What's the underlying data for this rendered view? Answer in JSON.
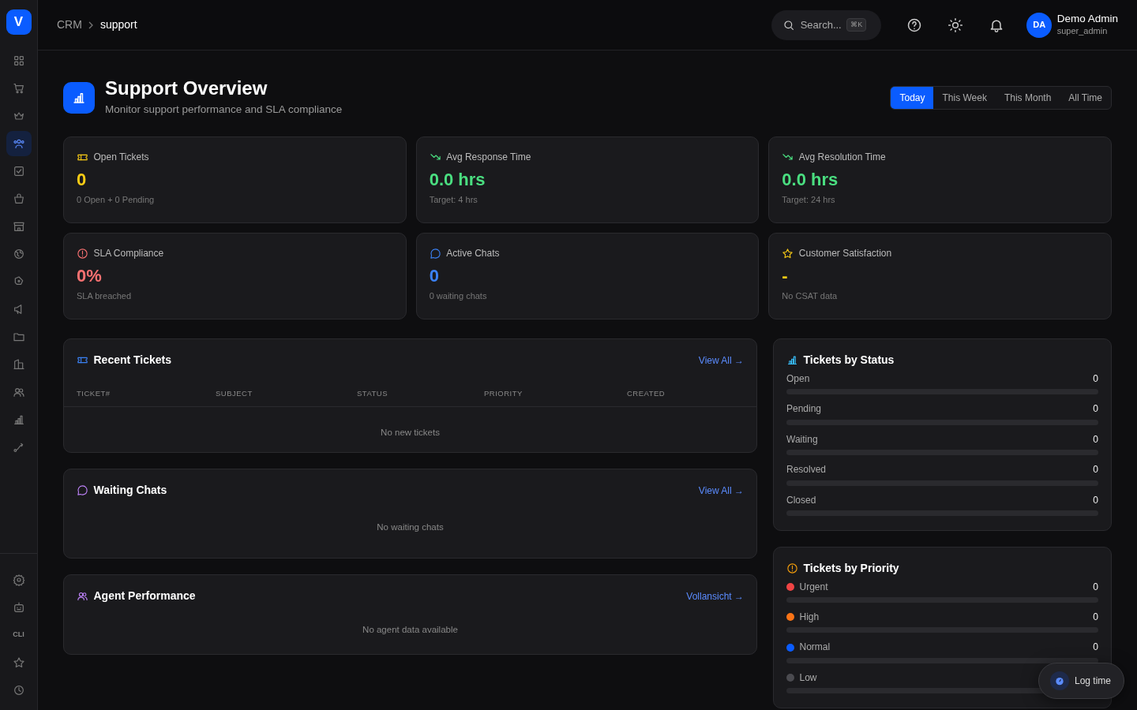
{
  "sidebar": {
    "logo": "V",
    "top_items": [
      {
        "selected": false
      },
      {
        "selected": false
      },
      {
        "selected": false
      },
      {
        "selected": true
      },
      {
        "selected": false
      },
      {
        "selected": false
      },
      {
        "selected": false
      },
      {
        "selected": false
      },
      {
        "selected": false
      },
      {
        "selected": false
      },
      {
        "selected": false
      },
      {
        "selected": false
      },
      {
        "selected": false
      },
      {
        "selected": false
      },
      {
        "selected": false
      }
    ],
    "bottom_items": [
      {
        "selected": false
      },
      {
        "selected": false
      },
      {
        "label": "CLI",
        "selected": false
      },
      {
        "selected": false
      },
      {
        "selected": false
      }
    ]
  },
  "header": {
    "breadcrumb": [
      "CRM",
      "support"
    ],
    "search": {
      "placeholder": "Search...",
      "shortcut": "⌘K"
    },
    "user": {
      "initials": "DA",
      "name": "Demo Admin",
      "role": "super_admin"
    }
  },
  "page": {
    "title": "Support Overview",
    "subtitle": "Monitor support performance and SLA compliance",
    "periods": [
      {
        "label": "Today",
        "selected": true
      },
      {
        "label": "This Week",
        "selected": false
      },
      {
        "label": "This Month",
        "selected": false
      },
      {
        "label": "All Time",
        "selected": false
      }
    ]
  },
  "stats": [
    {
      "title": "Open Tickets",
      "value": "0",
      "note": "0 Open + 0 Pending",
      "color": "#facc15"
    },
    {
      "title": "Avg Response Time",
      "value": "0.0 hrs",
      "note": "Target: 4 hrs",
      "color": "#4ade80"
    },
    {
      "title": "Avg Resolution Time",
      "value": "0.0 hrs",
      "note": "Target: 24 hrs",
      "color": "#4ade80"
    },
    {
      "title": "SLA Compliance",
      "value": "0%",
      "note": "SLA breached",
      "color": "#f87171"
    },
    {
      "title": "Active Chats",
      "value": "0",
      "note": "0 waiting chats",
      "color": "#3b82f6"
    },
    {
      "title": "Customer Satisfaction",
      "value": "-",
      "note": "No CSAT data",
      "color": "#facc15"
    }
  ],
  "recent_tickets": {
    "title": "Recent Tickets",
    "link": "View All →",
    "columns": [
      "TICKET#",
      "SUBJECT",
      "STATUS",
      "PRIORITY",
      "CREATED"
    ],
    "empty": "No new tickets"
  },
  "waiting_chats": {
    "title": "Waiting Chats",
    "link": "View All →",
    "empty": "No waiting chats"
  },
  "agent_performance": {
    "title": "Agent Performance",
    "link": "Vollansicht →",
    "empty": "No agent data available"
  },
  "tickets_by_status": {
    "title": "Tickets by Status",
    "rows": [
      {
        "label": "Open",
        "count": "0",
        "level": 0
      },
      {
        "label": "Pending",
        "count": "0",
        "level": 0
      },
      {
        "label": "Waiting",
        "count": "0",
        "level": 0
      },
      {
        "label": "Resolved",
        "count": "0",
        "level": 0
      },
      {
        "label": "Closed",
        "count": "0",
        "level": 0
      }
    ]
  },
  "tickets_by_priority": {
    "title": "Tickets by Priority",
    "rows": [
      {
        "label": "Urgent",
        "count": "0",
        "level": 0,
        "color": "#ef4444"
      },
      {
        "label": "High",
        "count": "0",
        "level": 0,
        "color": "#f97316"
      },
      {
        "label": "Normal",
        "count": "0",
        "level": 0,
        "color": "#0a5cff"
      },
      {
        "label": "Low",
        "level": 0,
        "color": "#4b4b50"
      }
    ]
  },
  "log_time_button": "Log time"
}
